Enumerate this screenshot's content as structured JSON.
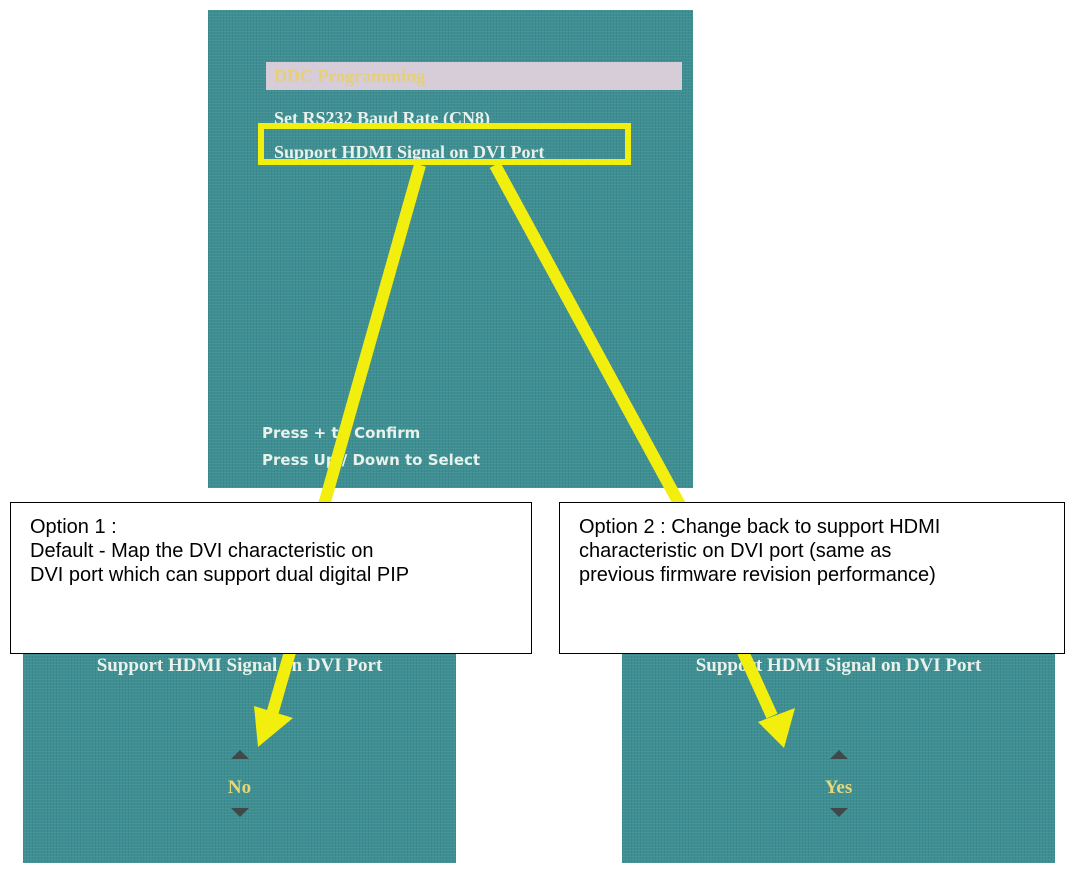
{
  "main_menu": {
    "items": [
      {
        "label": "DDC Programming",
        "state": "selected"
      },
      {
        "label": "Set RS232 Baud Rate (CN8)"
      },
      {
        "label": "Support HDMI Signal on DVI Port",
        "highlighted": true
      }
    ],
    "hints": {
      "confirm": "Press + to Confirm",
      "select": "Press Up / Down to Select"
    }
  },
  "callouts": {
    "option1": {
      "lines": [
        "Option 1 :",
        "Default - Map the DVI characteristic on",
        "DVI port which can support dual digital PIP"
      ]
    },
    "option2": {
      "lines": [
        "Option 2 : Change back to support HDMI",
        "characteristic on DVI port (same as",
        "previous firmware revision performance)"
      ]
    }
  },
  "sub_menus": {
    "option1": {
      "title": "Support HDMI Signal on DVI Port",
      "value": "No"
    },
    "option2": {
      "title": "Support HDMI Signal on DVI Port",
      "value": "Yes"
    }
  },
  "colors": {
    "osd_background": "#3e8f93",
    "highlight": "#f2ee0d",
    "selected_bar": "#d6cdd8",
    "value_text": "#e6d77a"
  }
}
